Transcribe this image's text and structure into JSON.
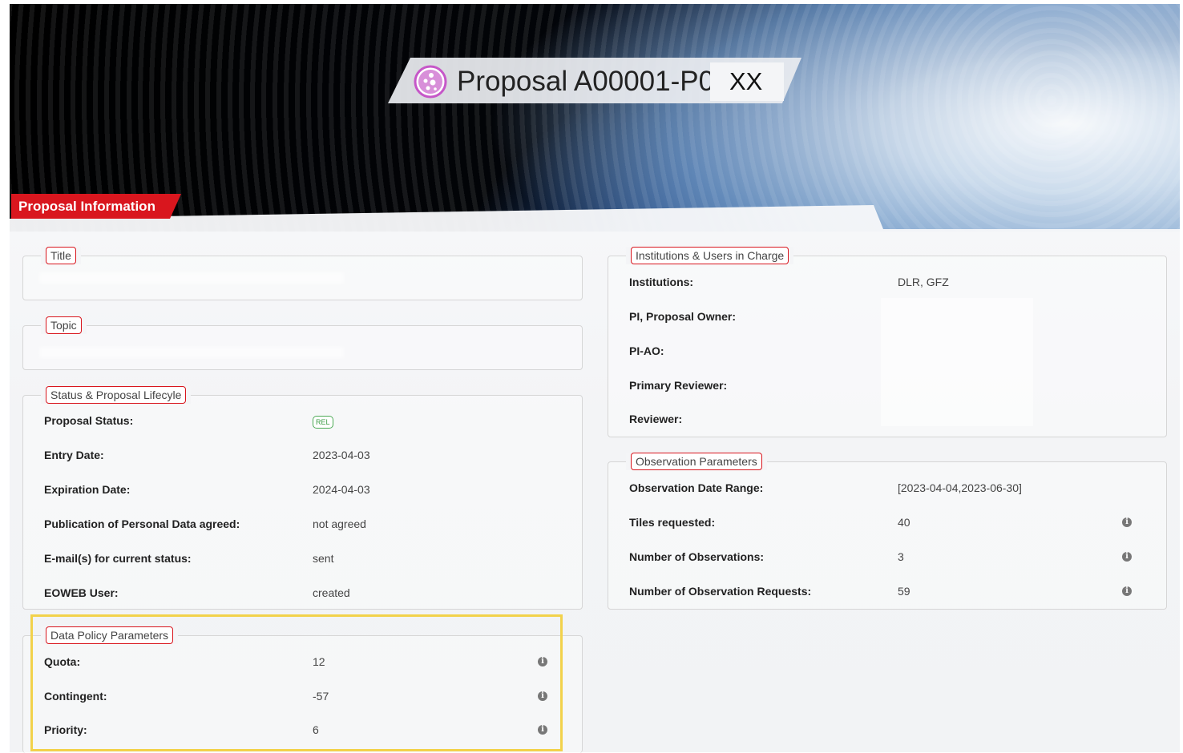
{
  "header": {
    "title": "Proposal A00001-P0",
    "title_suffix": "XX",
    "icon": "proposal-bubbles-icon"
  },
  "section_tab": "Proposal Information",
  "title_box": {
    "legend": "Title",
    "value": ""
  },
  "topic_box": {
    "legend": "Topic",
    "value": ""
  },
  "status": {
    "legend": "Status & Proposal Lifecyle",
    "rows": [
      {
        "label": "Proposal Status:",
        "value": "REL"
      },
      {
        "label": "Entry Date:",
        "value": "2023-04-03"
      },
      {
        "label": "Expiration Date:",
        "value": "2024-04-03"
      },
      {
        "label": "Publication of Personal Data agreed:",
        "value": "not agreed"
      },
      {
        "label": "E-mail(s) for current status:",
        "value": "sent"
      },
      {
        "label": "EOWEB User:",
        "value": "created"
      }
    ]
  },
  "data_policy": {
    "legend": "Data Policy Parameters",
    "rows": [
      {
        "label": "Quota:",
        "value": "12"
      },
      {
        "label": "Contingent:",
        "value": "-57"
      },
      {
        "label": "Priority:",
        "value": "6"
      }
    ]
  },
  "institutions": {
    "legend": "Institutions & Users in Charge",
    "rows": [
      {
        "label": "Institutions:",
        "value": "DLR, GFZ"
      },
      {
        "label": "PI, Proposal Owner:",
        "value": ""
      },
      {
        "label": "PI-AO:",
        "value": ""
      },
      {
        "label": "Primary Reviewer:",
        "value": ""
      },
      {
        "label": "Reviewer:",
        "value": ""
      }
    ]
  },
  "observation": {
    "legend": "Observation Parameters",
    "rows": [
      {
        "label": "Observation Date Range:",
        "value": "[2023-04-04,2023-06-30]"
      },
      {
        "label": "Tiles requested:",
        "value": "40"
      },
      {
        "label": "Number of Observations:",
        "value": "3"
      },
      {
        "label": "Number of Observation Requests:",
        "value": "59"
      }
    ]
  },
  "colors": {
    "accent": "#d9161e",
    "highlight": "#f2d24b",
    "status_badge": "#3a9a44"
  }
}
